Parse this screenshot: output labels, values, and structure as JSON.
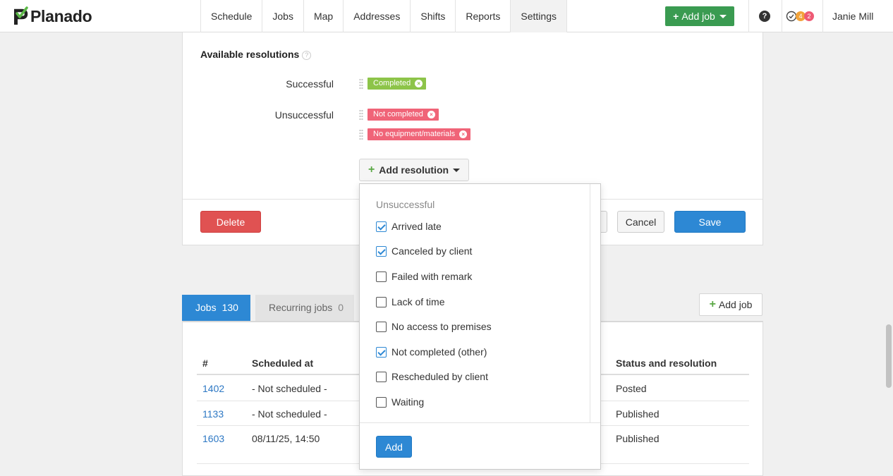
{
  "app": {
    "name": "Planado"
  },
  "nav": {
    "items": [
      "Schedule",
      "Jobs",
      "Map",
      "Addresses",
      "Shifts",
      "Reports",
      "Settings"
    ],
    "active": "Settings",
    "add_job_label": "Add job",
    "help_icon": "question-circle-icon",
    "notifications": {
      "icon": "check-circle-icon",
      "orange_count": "4",
      "red_count": "2"
    },
    "user_name": "Janie Mill"
  },
  "resolutions": {
    "title": "Available resolutions",
    "successful_label": "Successful",
    "unsuccessful_label": "Unsuccessful",
    "successful_tags": [
      "Completed"
    ],
    "unsuccessful_tags": [
      "Not completed",
      "No equipment/materials"
    ],
    "add_resolution_label": "Add resolution"
  },
  "actions": {
    "delete": "Delete",
    "cancel": "Cancel",
    "save": "Save"
  },
  "dropdown": {
    "group": "Unsuccessful",
    "options": [
      {
        "label": "Arrived late",
        "checked": true
      },
      {
        "label": "Canceled by client",
        "checked": true
      },
      {
        "label": "Failed with remark",
        "checked": false
      },
      {
        "label": "Lack of time",
        "checked": false
      },
      {
        "label": "No access to premises",
        "checked": false
      },
      {
        "label": "Not completed (other)",
        "checked": true
      },
      {
        "label": "Rescheduled by client",
        "checked": false
      },
      {
        "label": "Waiting",
        "checked": false
      }
    ],
    "add_label": "Add"
  },
  "jobs": {
    "tabs": [
      {
        "label": "Jobs",
        "count": "130"
      },
      {
        "label": "Recurring jobs",
        "count": "0"
      }
    ],
    "add_job_label": "Add job",
    "columns": {
      "number": "#",
      "scheduled": "Scheduled at",
      "status": "Status and resolution"
    },
    "rows": [
      {
        "number": "1402",
        "scheduled": "- Not scheduled -",
        "status": "Posted"
      },
      {
        "number": "1133",
        "scheduled": "- Not scheduled -",
        "status": "Published"
      },
      {
        "number": "1603",
        "scheduled": "08/11/25, 14:50",
        "status": "Published"
      }
    ]
  },
  "colors": {
    "primary": "#2d88d4",
    "success": "#3a9b51",
    "danger": "#e05252",
    "tag_green": "#8dc449",
    "tag_red": "#f06478"
  }
}
